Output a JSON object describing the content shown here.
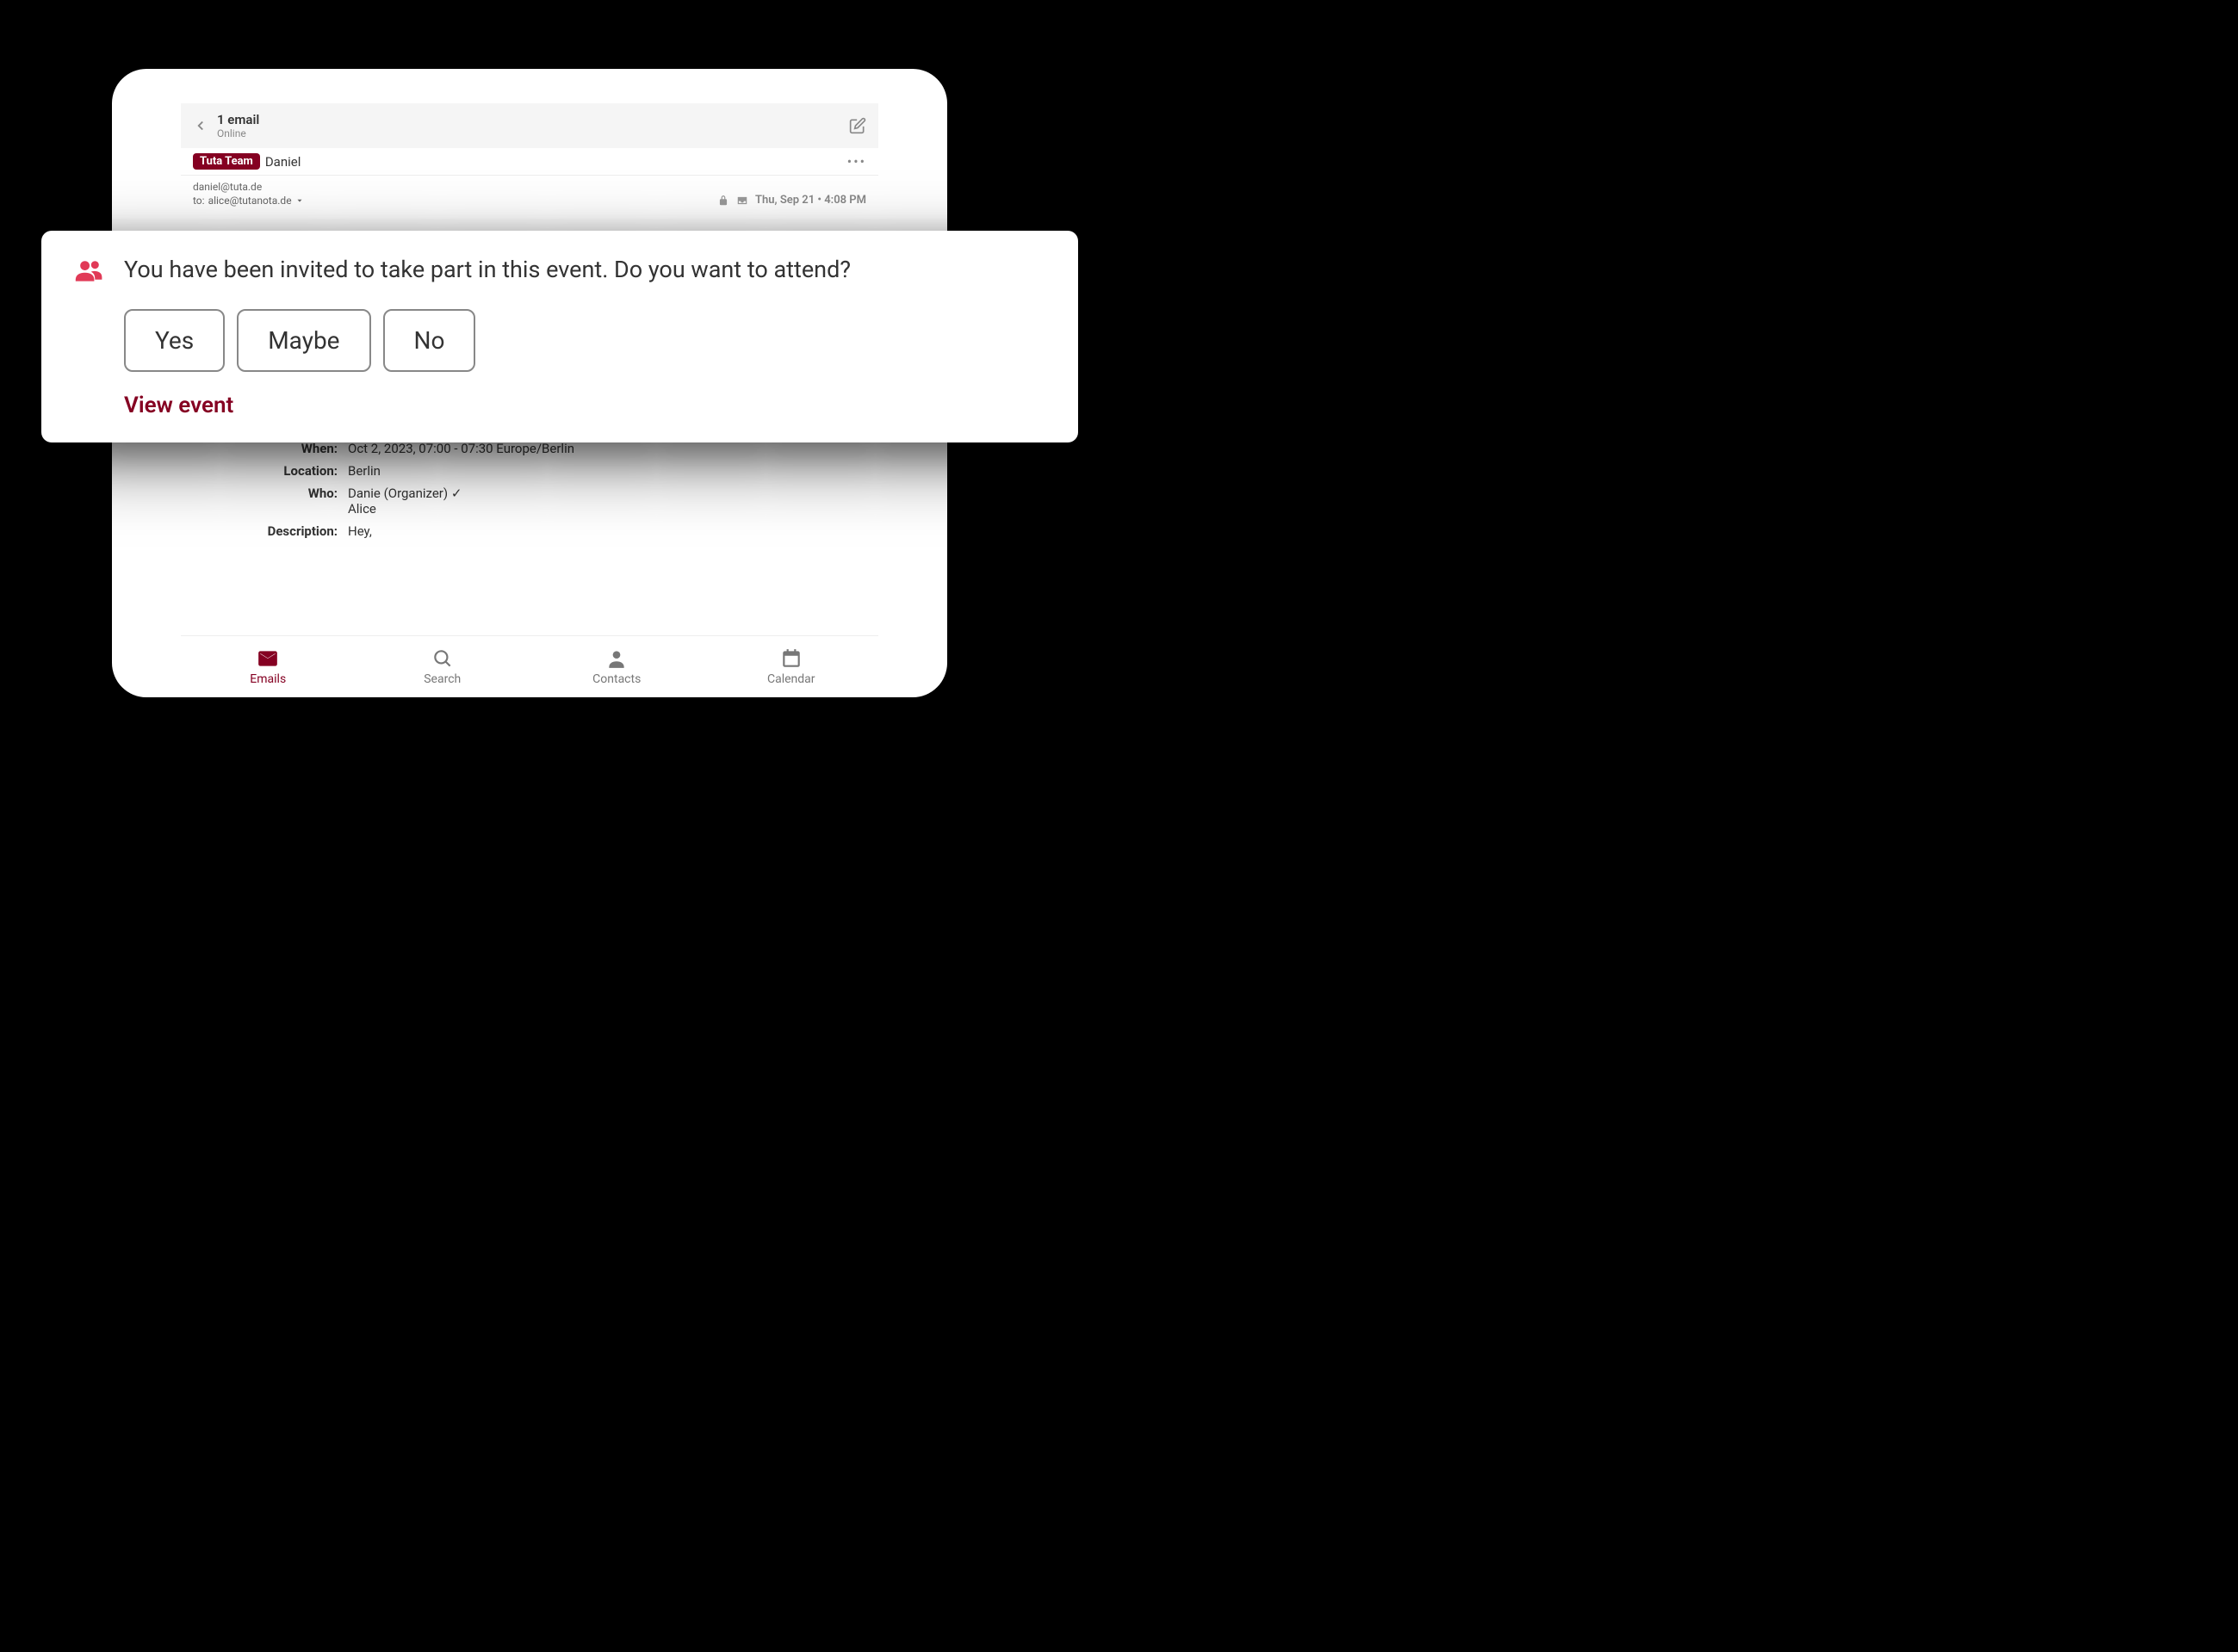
{
  "header": {
    "count_label": "1 email",
    "status": "Online"
  },
  "sender": {
    "badge": "Tuta Team",
    "name": "Daniel"
  },
  "addresses": {
    "from": "daniel@tuta.de",
    "to_prefix": "to:",
    "to": "alice@tutanota.de"
  },
  "meta": {
    "timestamp": "Thu, Sep 21 • 4:08 PM"
  },
  "dialog": {
    "prompt": "You have been invited to take part in this event. Do you want to attend?",
    "buttons": {
      "yes": "Yes",
      "maybe": "Maybe",
      "no": "No"
    },
    "view_event": "View event"
  },
  "event": {
    "when_label": "When:",
    "when_value": "Oct 2, 2023, 07:00 - 07:30 Europe/Berlin",
    "location_label": "Location:",
    "location_value": "Berlin",
    "who_label": "Who:",
    "who_line1": "Danie (Organizer) ✓",
    "who_line2": "Alice",
    "description_label": "Description:",
    "description_value": "Hey,"
  },
  "nav": {
    "emails": "Emails",
    "search": "Search",
    "contacts": "Contacts",
    "calendar": "Calendar"
  }
}
